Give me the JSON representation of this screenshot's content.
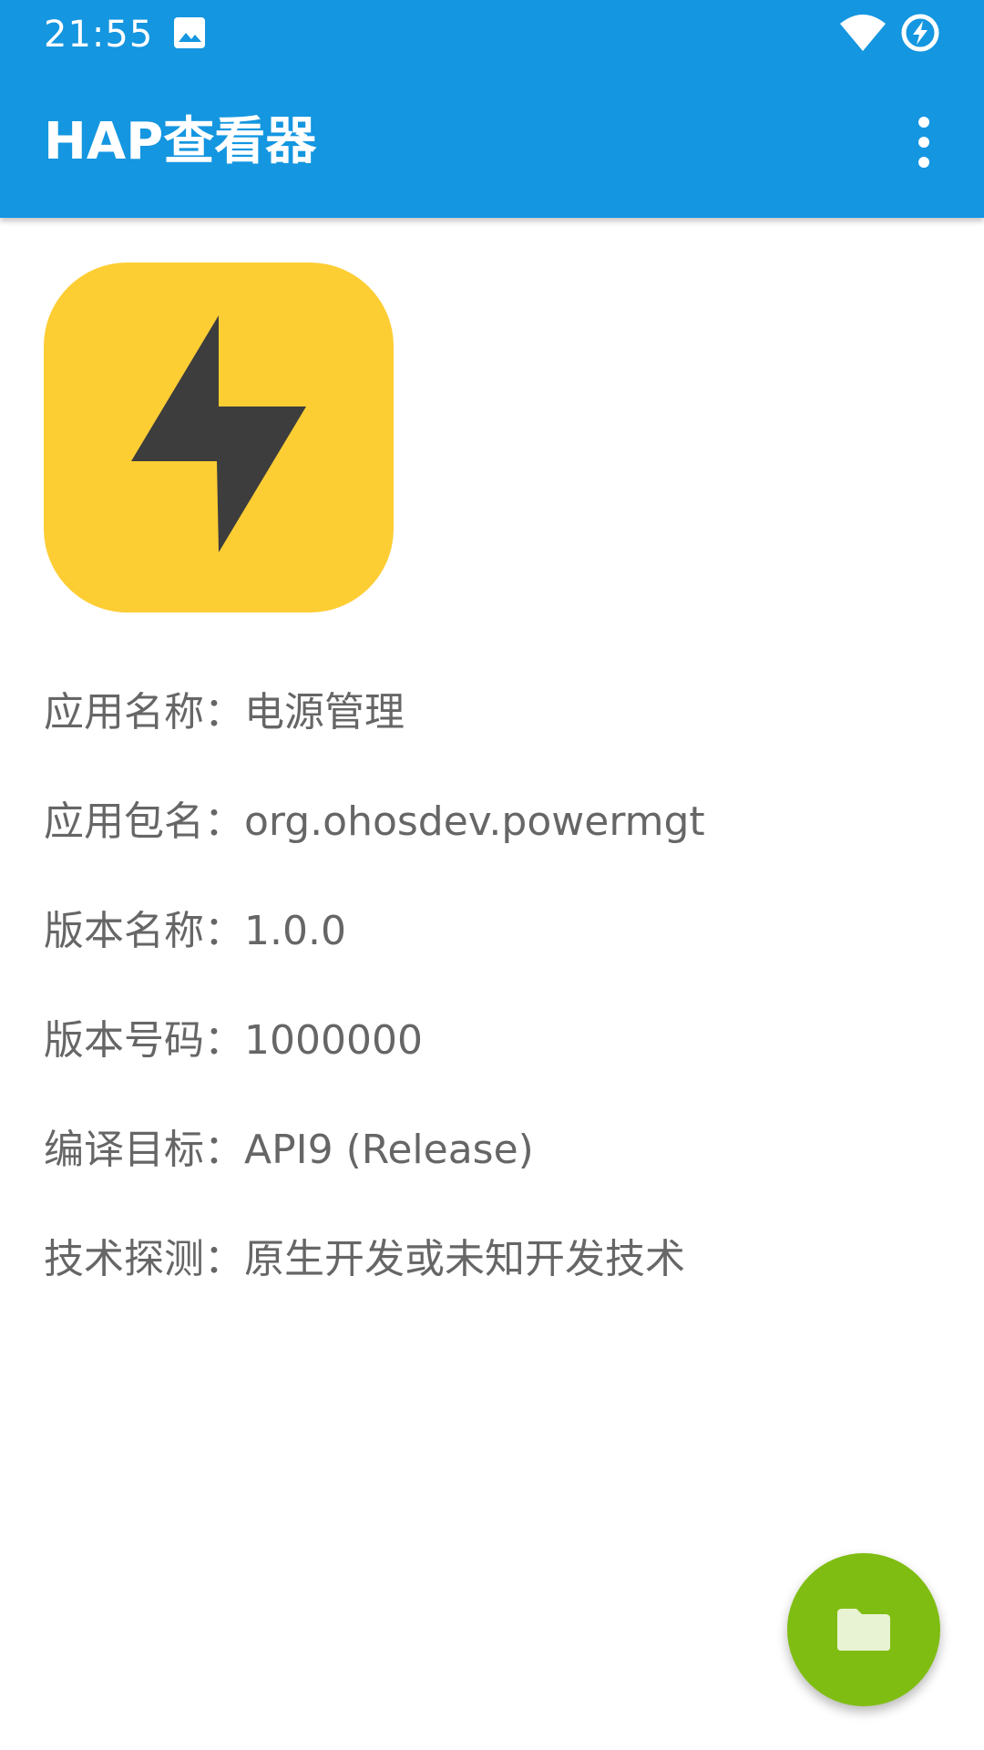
{
  "status_bar": {
    "time": "21:55",
    "icons": [
      "gallery-icon",
      "wifi-icon",
      "battery-charging-icon"
    ]
  },
  "app_bar": {
    "title": "HAP查看器",
    "menu_icon": "more-vert-icon"
  },
  "app_info": {
    "icon": "lightning-bolt-icon",
    "icon_bg_color": "#fdcd34",
    "icon_fg_color": "#3d3d3d",
    "rows": [
      {
        "label": "应用名称：",
        "value": "电源管理"
      },
      {
        "label": "应用包名：",
        "value": "org.ohosdev.powermgt"
      },
      {
        "label": "版本名称：",
        "value": "1.0.0"
      },
      {
        "label": "版本号码：",
        "value": "1000000"
      },
      {
        "label": "编译目标：",
        "value": "API9 (Release)"
      },
      {
        "label": "技术探测：",
        "value": "原生开发或未知开发技术"
      }
    ]
  },
  "fab": {
    "icon": "folder-icon",
    "color": "#80bd13"
  },
  "colors": {
    "app_bar": "#1496e0",
    "text_secondary": "#666666"
  }
}
